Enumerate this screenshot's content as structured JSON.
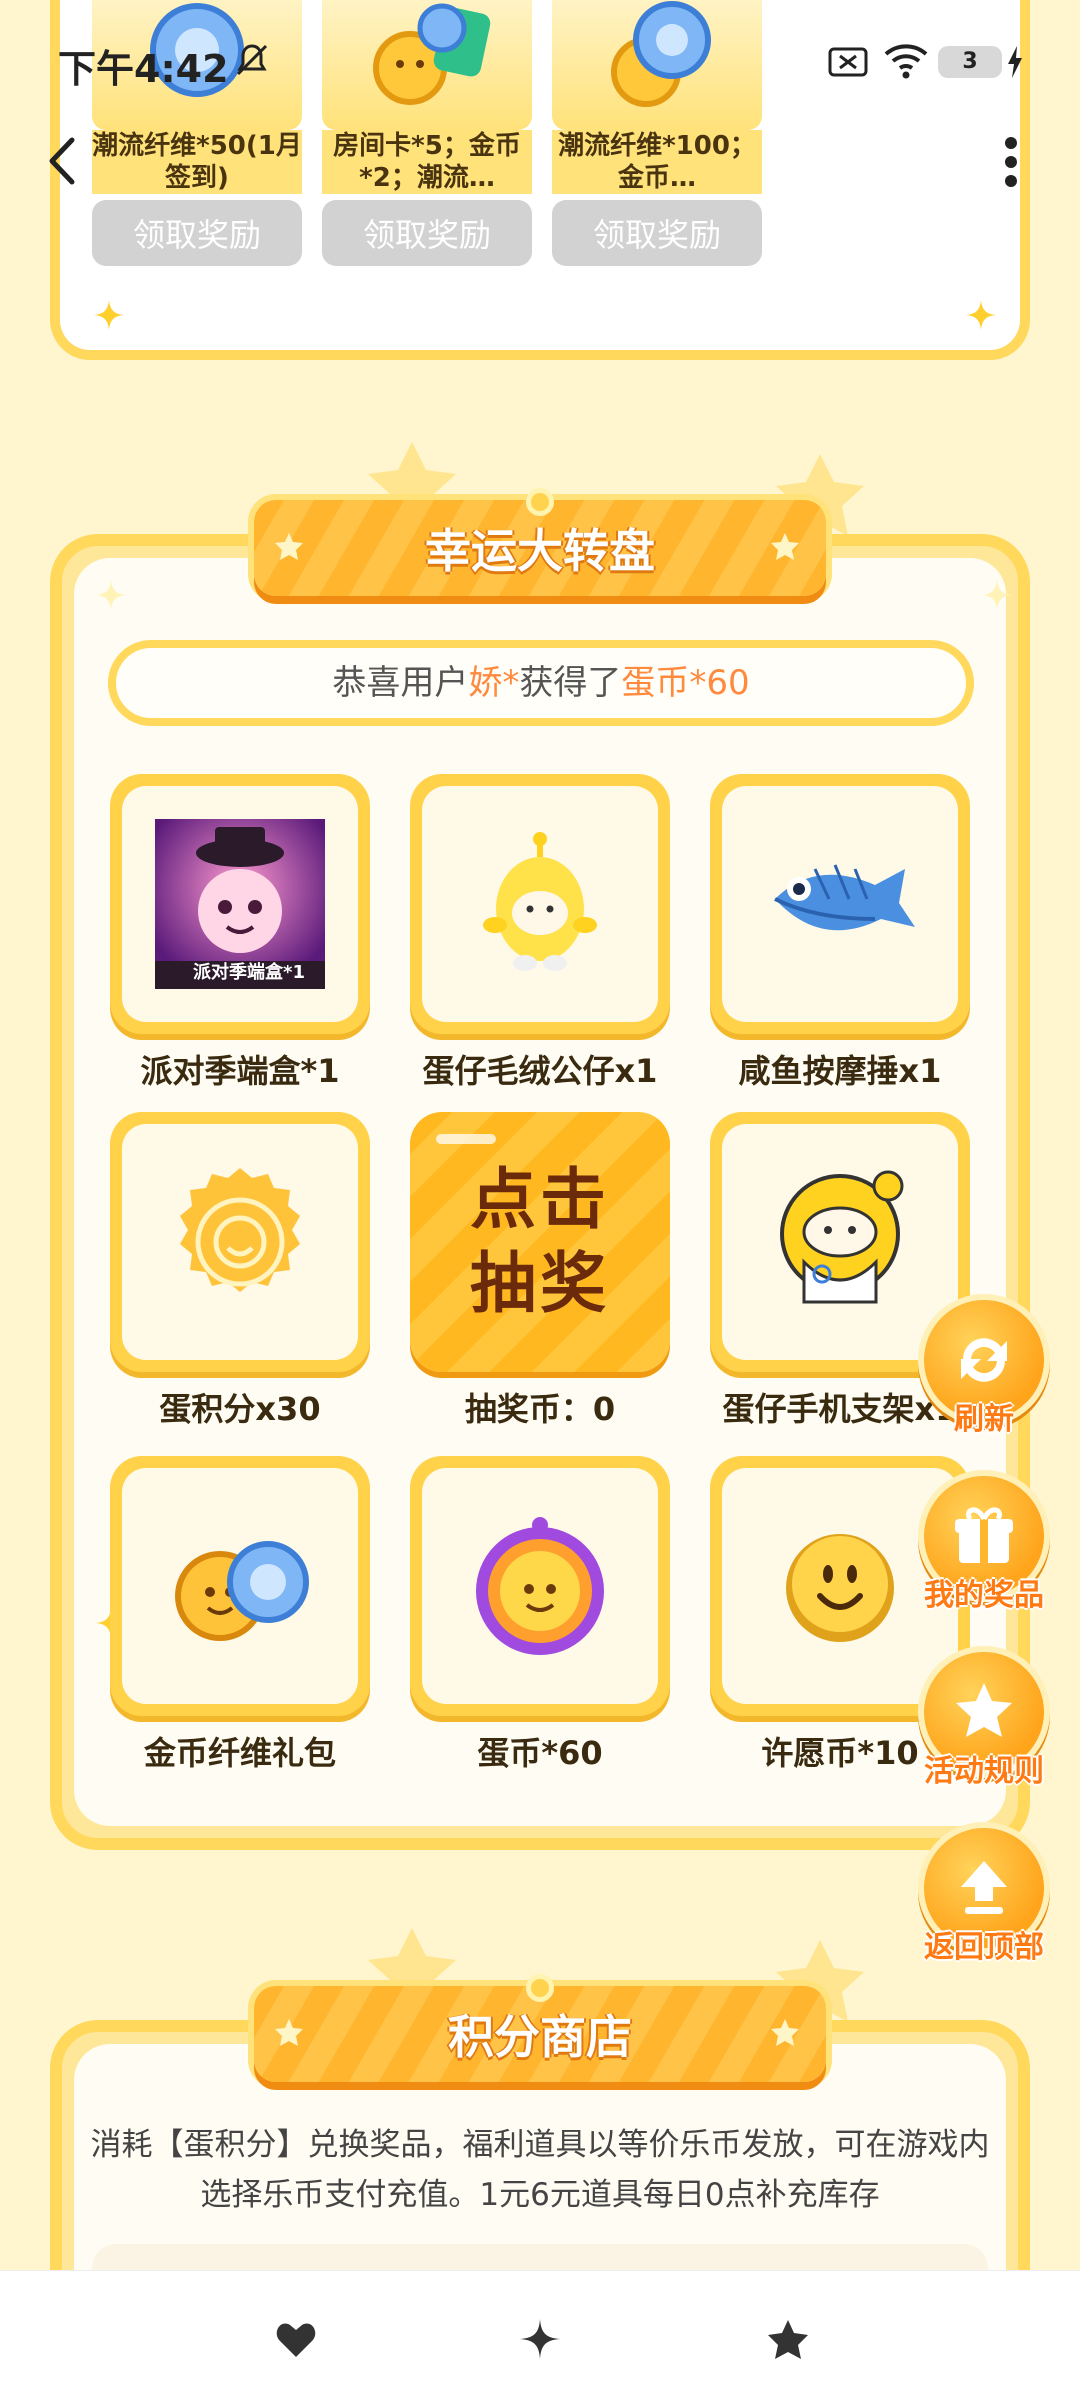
{
  "status_bar": {
    "time": "下午4:42",
    "battery_level": "3"
  },
  "sign_in_rewards": [
    {
      "label": "潮流纤维*50(1月签到)",
      "button": "领取奖励"
    },
    {
      "label": "房间卡*5；金币*2；潮流…",
      "button": "领取奖励"
    },
    {
      "label": "潮流纤维*100；金币…",
      "button": "领取奖励"
    }
  ],
  "lucky_wheel": {
    "title": "幸运大转盘",
    "marquee": {
      "prefix": "恭喜用户",
      "user": "娇*",
      "middle": "获得了",
      "prize": "蛋币*60"
    },
    "prizes": [
      {
        "name": "派对季端盒*1",
        "caption": "派对季端盒*1"
      },
      {
        "name": "蛋仔毛绒公仔x1"
      },
      {
        "name": "咸鱼按摩捶x1"
      },
      {
        "name": "蛋积分x30"
      },
      {
        "name": "抽奖币：0",
        "draw_text": "点击抽奖"
      },
      {
        "name": "蛋仔手机支架x1"
      },
      {
        "name": "金币纤维礼包"
      },
      {
        "name": "蛋币*60"
      },
      {
        "name": "许愿币*10"
      }
    ]
  },
  "floating_buttons": {
    "refresh": "刷新",
    "my_prizes": "我的奖品",
    "rules": "活动规则",
    "back_to_top": "返回顶部"
  },
  "points_shop": {
    "title": "积分商店",
    "description": "消耗【蛋积分】兑换奖品，福利道具以等价乐币发放，可在游戏内选择乐币支付充值。1元6元道具每日0点补充库存"
  },
  "icons": {
    "back": "chevron-left-icon",
    "more": "more-vertical-icon",
    "nav": [
      "heart-icon",
      "sparkle-icon",
      "star-icon"
    ]
  },
  "colors": {
    "accent_orange": "#ff8a3d",
    "banner_yellow": "#ffb52e",
    "frame_yellow": "#ffd85c",
    "page_bg": "#fff6cf"
  }
}
